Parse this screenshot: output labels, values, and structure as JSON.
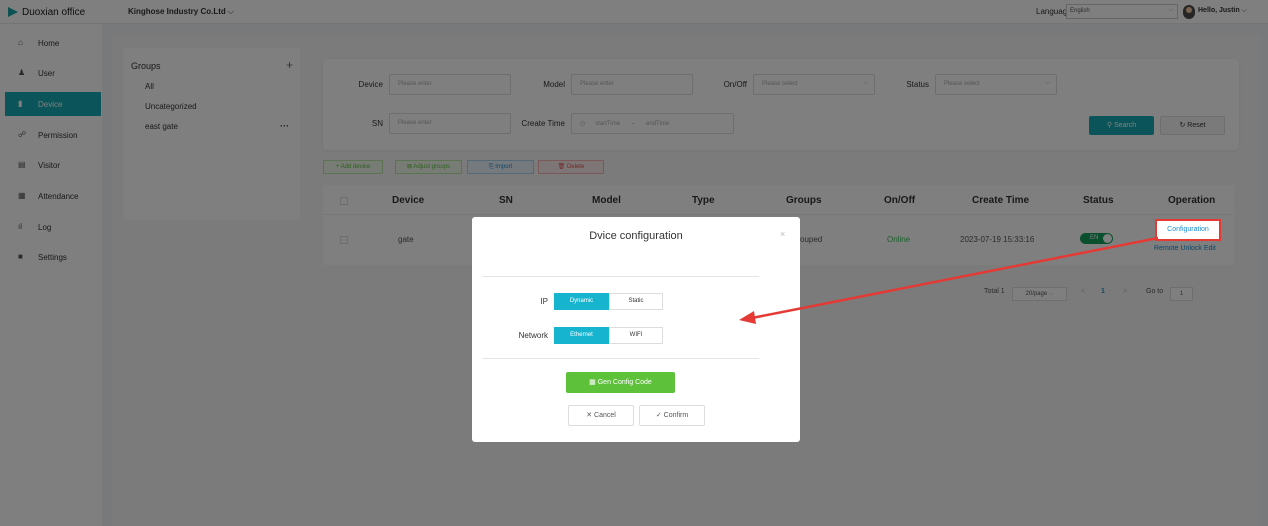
{
  "topbar": {
    "brand": "Duoxian office",
    "company": "Kinghose Industry Co.Ltd",
    "language_label": "Language",
    "language_value": "English",
    "greeting": "Hello,  Justin"
  },
  "sidebar": {
    "items": [
      {
        "label": "Home",
        "icon": "home-icon"
      },
      {
        "label": "User",
        "icon": "user-icon"
      },
      {
        "label": "Device",
        "icon": "device-icon",
        "active": true
      },
      {
        "label": "Permission",
        "icon": "permission-icon"
      },
      {
        "label": "Visitor",
        "icon": "visitor-icon"
      },
      {
        "label": "Attendance",
        "icon": "calendar-icon"
      },
      {
        "label": "Log",
        "icon": "chart-icon"
      },
      {
        "label": "Settings",
        "icon": "settings-icon"
      }
    ]
  },
  "groups": {
    "title": "Groups",
    "items": [
      "All",
      "Uncategorized",
      "east gate"
    ]
  },
  "filter": {
    "device_label": "Device",
    "device_placeholder": "Please enter",
    "model_label": "Model",
    "model_placeholder": "Please enter",
    "onoff_label": "On/Off",
    "onoff_placeholder": "Please select",
    "status_label": "Status",
    "status_placeholder": "Please select",
    "sn_label": "SN",
    "sn_placeholder": "Please enter",
    "create_time_label": "Create Time",
    "start_time": "startTime",
    "time_separator": "-",
    "end_time": "endTime",
    "search_label": "Search",
    "reset_label": "Reset"
  },
  "actions": {
    "add_device": "+ Add device",
    "adjust_groups": "Adjust groups",
    "import": "Import",
    "delete": "Delete"
  },
  "table": {
    "headers": [
      "Device",
      "SN",
      "Model",
      "Type",
      "Groups",
      "On/Off",
      "Create Time",
      "Status",
      "Operation"
    ],
    "row": {
      "device": "gate",
      "groups": "ouped",
      "onoff": "Online",
      "create_time": "2023-07-19 15:33:16",
      "status": "EN",
      "configuration": "Configuration",
      "remote_unlock": "Remote Unlock",
      "edit": "Edit"
    }
  },
  "pagination": {
    "total": "Total 1",
    "page_size": "20/page",
    "prev": "<",
    "current": "1",
    "next": ">",
    "goto_label": "Go to",
    "goto_value": "1"
  },
  "modal": {
    "title": "Dvice configuration",
    "close": "×",
    "ip_label": "IP",
    "ip_options": [
      "Dynamic",
      "Static"
    ],
    "ip_selected": "Dynamic",
    "network_label": "Network",
    "network_options": [
      "Ethernet",
      "WIFI"
    ],
    "network_selected": "Ethernet",
    "gen_label": "Gen Config Code",
    "cancel_label": "Cancel",
    "confirm_label": "Confirm"
  },
  "colors": {
    "accent": "#17aab5",
    "segment_active": "#17b4cf",
    "gen_button": "#5ec13a",
    "annotation_red": "#e53935",
    "link": "#1a8fd2",
    "online": "#3bbf5a"
  }
}
